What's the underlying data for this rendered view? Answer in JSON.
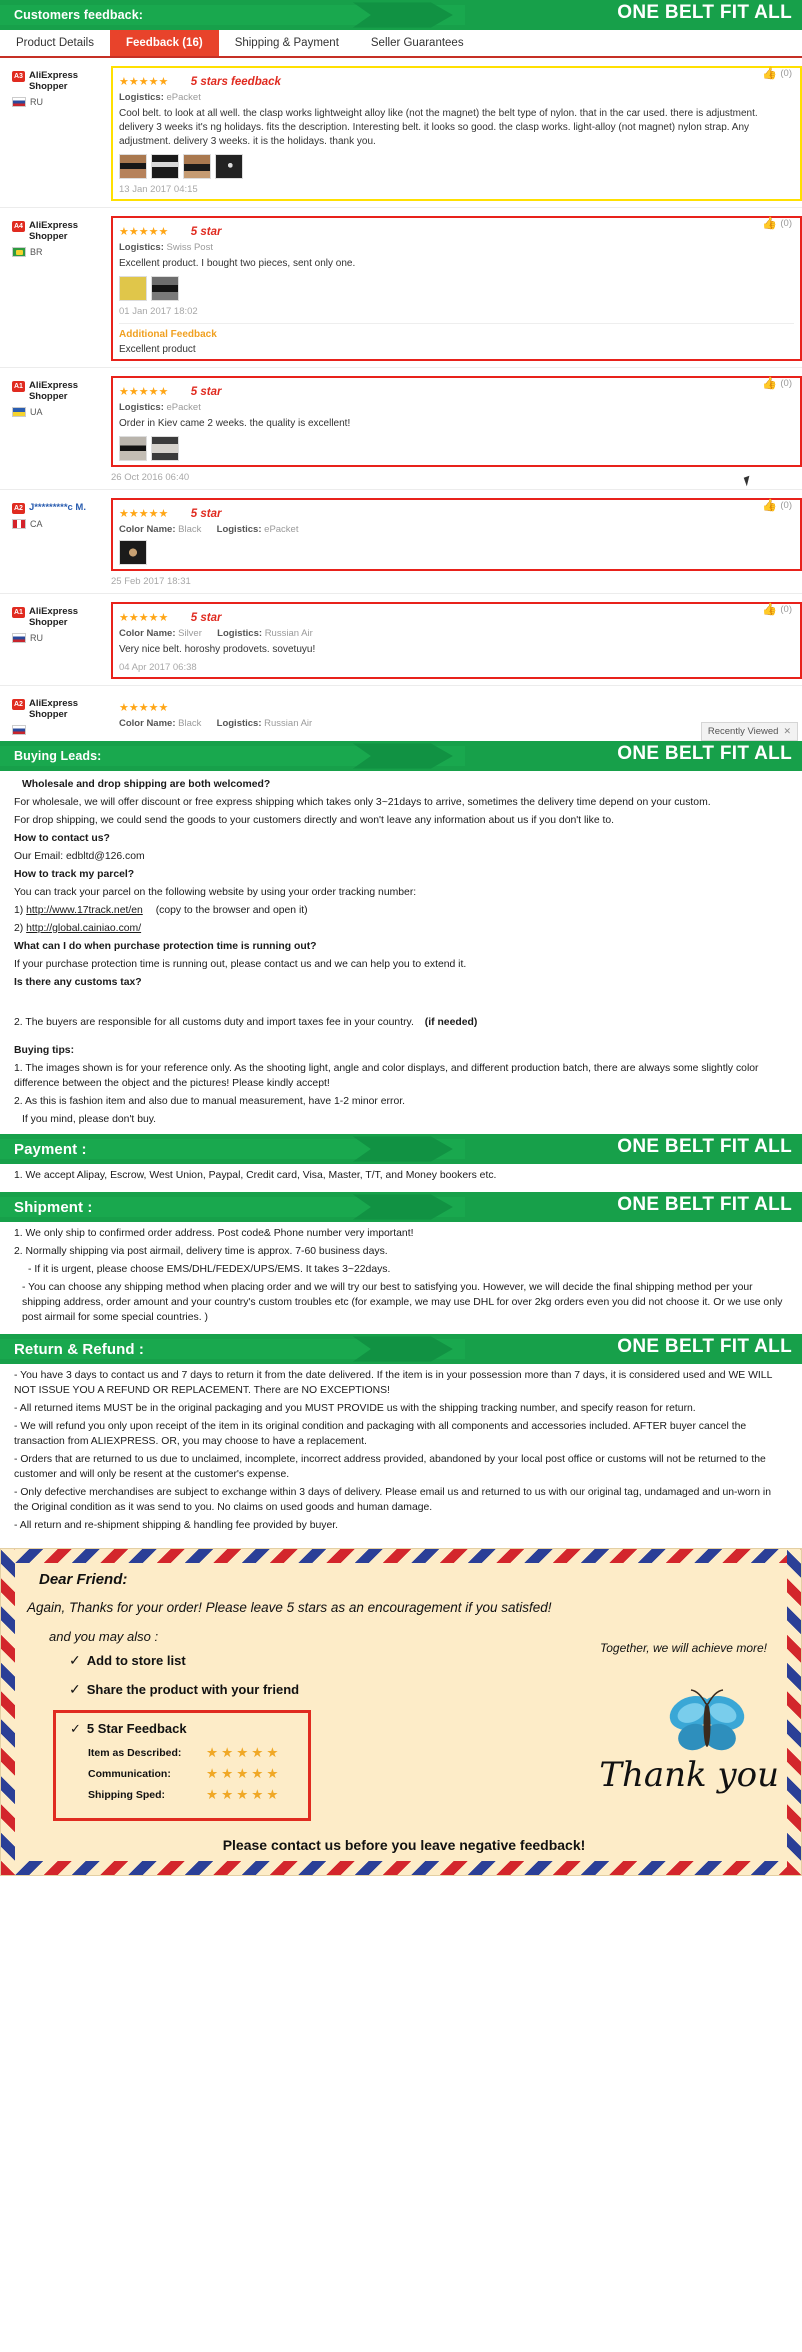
{
  "banners": {
    "customers_feedback": "Customers feedback:",
    "buying_leads": "Buying Leads:",
    "payment": "Payment :",
    "shipment": "Shipment :",
    "return_refund": "Return & Refund :",
    "slogan": "ONE BELT FIT ALL"
  },
  "tabs": [
    {
      "label": "Product Details",
      "active": false
    },
    {
      "label": "Feedback (16)",
      "active": true
    },
    {
      "label": "Shipping & Payment",
      "active": false
    },
    {
      "label": "Seller Guarantees",
      "active": false
    }
  ],
  "feedback": [
    {
      "badge": "A3",
      "username": "AliExpress Shopper",
      "country": "RU",
      "flag": "flag-ru",
      "stars": "★★★★★",
      "note": "5 stars feedback",
      "meta_label": "Logistics:",
      "meta_value": "ePacket",
      "text": "Cool belt. to look at all well. the clasp works lightweight alloy like (not the magnet) the belt type of nylon. that in the car used. there is adjustment. delivery 3 weeks it's ng holidays. fits the description. Interesting belt. it looks so good. the clasp works. light-alloy (not magnet) nylon strap. Any adjustment. delivery 3 weeks. it is the holidays. thank you.",
      "thumbs": [
        "t1",
        "t2",
        "t3",
        "t4"
      ],
      "date": "13 Jan 2017 04:15",
      "helpful": "(0)",
      "outline": "yellow"
    },
    {
      "badge": "A4",
      "username": "AliExpress Shopper",
      "country": "BR",
      "flag": "flag-br",
      "stars": "★★★★★",
      "note": "5 star",
      "meta_label": "Logistics:",
      "meta_value": "Swiss Post",
      "text": "Excellent product. I bought two pieces, sent only one.",
      "thumbs": [
        "y1",
        "y2"
      ],
      "date": "01 Jan 2017 18:02",
      "additional_title": "Additional Feedback",
      "additional_text": "Excellent product",
      "helpful": "(0)",
      "outline": "red"
    },
    {
      "badge": "A1",
      "username": "AliExpress Shopper",
      "country": "UA",
      "flag": "flag-ua",
      "stars": "★★★★★",
      "note": "5 star",
      "meta_label": "Logistics:",
      "meta_value": "ePacket",
      "text": "Order in Kiev came 2 weeks. the quality is excellent!",
      "thumbs": [
        "g1",
        "g2"
      ],
      "date": "26 Oct 2016 06:40",
      "helpful": "(0)",
      "outline": "red"
    },
    {
      "badge": "A2",
      "username": "J*********c M.",
      "country": "CA",
      "flag": "flag-ca",
      "stars": "★★★★★",
      "note": "5 star",
      "color_label": "Color Name:",
      "color_value": "Black",
      "meta_label": "Logistics:",
      "meta_value": "ePacket",
      "text": "",
      "thumbs": [
        "blk"
      ],
      "date": "25 Feb 2017 18:31",
      "helpful": "(0)",
      "outline": "red"
    },
    {
      "badge": "A1",
      "username": "AliExpress Shopper",
      "country": "RU",
      "flag": "flag-ru",
      "stars": "★★★★★",
      "note": "5 star",
      "color_label": "Color Name:",
      "color_value": "Silver",
      "meta_label": "Logistics:",
      "meta_value": "Russian Air",
      "text": "Very nice belt. horoshy prodovets. sovetuyu!",
      "thumbs": [],
      "date": "04 Apr 2017 06:38",
      "helpful": "(0)",
      "outline": "red"
    },
    {
      "badge": "A2",
      "username": "AliExpress Shopper",
      "country": "",
      "flag": "flag-ru",
      "stars": "★★★★★",
      "note": "",
      "color_label": "Color Name:",
      "color_value": "Black",
      "meta_label": "Logistics:",
      "meta_value": "Russian Air",
      "text": "",
      "thumbs": [],
      "date": "",
      "helpful": "",
      "outline": "none"
    }
  ],
  "recently_viewed": {
    "label": "Recently Viewed",
    "close": "✕"
  },
  "leads": {
    "q1": "Wholesale and drop shipping are both welcomed?",
    "a1a": "For wholesale, we will offer discount or free express shipping which takes only 3~21days to arrive, sometimes the delivery time depend on your custom.",
    "a1b": "For drop shipping, we could send the goods to your customers directly and won't leave any information about us if you don't like to.",
    "q2": "How to contact us?",
    "a2": "Our Email: edbltd@126.com",
    "q3": "How to track my parcel?",
    "a3": "You can track your parcel on the following website by using your order tracking number:",
    "link1_prefix": "1)",
    "link1": "http://www.17track.net/en",
    "link1_note": "(copy to the browser and open it)",
    "link2_prefix": "2)",
    "link2": "http://global.cainiao.com/",
    "q4": "What can I do when purchase protection time is running out?",
    "a4": "If your purchase protection time is running out, please contact us and we can help you to extend it.",
    "q5": "Is there any customs tax?",
    "a5": "2. The buyers are responsible for all customs duty and import taxes fee in your country.",
    "a5_bold": "(if needed)",
    "tips_title": "Buying tips:",
    "tip1": "1. The images shown is for your reference only. As the shooting light, angle and color displays, and different production batch, there are always some slightly color difference between the object and the pictures! Please kindly accept!",
    "tip2": "2. As this is fashion item and also due to manual measurement, have 1-2 minor error.",
    "tip3": "If you mind, please don't buy."
  },
  "payment": {
    "line1": "1. We accept Alipay, Escrow, West Union, Paypal, Credit card, Visa, Master, T/T, and Money bookers etc."
  },
  "shipment": {
    "line1": "1. We only ship to confirmed order address. Post code& Phone number very important!",
    "line2": "2. Normally shipping via post airmail, delivery time is approx. 7-60 business days.",
    "line3": "- If it is urgent, please choose EMS/DHL/FEDEX/UPS/EMS. It takes 3~22days.",
    "line4": "- You can choose any shipping method when placing order and we will try our best to satisfying you. However, we will decide the final shipping method per your shipping address, order amount and your country's custom troubles etc (for example, we may use DHL for over 2kg orders even you did not choose it. Or we use only post airmail for some special countries. )"
  },
  "returns": {
    "line1": "- You have 3 days to contact us and 7 days to return it from the date delivered. If the item is in your possession more than 7 days, it is considered used and WE WILL NOT ISSUE YOU A REFUND OR REPLACEMENT. There are NO EXCEPTIONS!",
    "line2": "- All returned items MUST be in the original packaging and you MUST PROVIDE us with the shipping tracking number, and specify reason for return.",
    "line3": "- We will refund you only upon receipt of the item in its original condition and packaging with all components and accessories included. AFTER buyer cancel the transaction from ALIEXPRESS. OR, you may choose to have a replacement.",
    "line4": "- Orders that are returned to us due to unclaimed, incomplete, incorrect address provided, abandoned by your local post office or customs will not be returned to the customer and will only be resent at the customer's expense.",
    "line5": "- Only defective merchandises are subject to exchange within 3 days of delivery. Please email us and returned to us with our original tag, undamaged and un-worn in the Original condition as it was send to you. No claims on used goods and human damage.",
    "line6": "- All return and re-shipment shipping & handling fee provided by buyer."
  },
  "thank_you": {
    "dear": "Dear Friend:",
    "line1": "Again, Thanks for your order! Please leave 5 stars as an encouragement if you satisfed!",
    "also": "and you may also :",
    "check1": "Add to store list",
    "check2": "Share the product with your friend",
    "check3": "5 Star Feedback",
    "together": "Together, we will achieve more!",
    "rate_rows": [
      {
        "label": "Item as Described:",
        "stars": "★★★★★"
      },
      {
        "label": "Communication:",
        "stars": "★★★★★"
      },
      {
        "label": "Shipping Sped:",
        "stars": "★★★★★"
      }
    ],
    "script": "Thank you",
    "footer": "Please contact us before you leave negative feedback!"
  },
  "colors": {
    "green": "#17a04a",
    "red": "#e8432b",
    "star_orange": "#ffa616",
    "outline_yellow": "#ffe000",
    "outline_red": "#e8221b",
    "cream": "#fdecc8"
  }
}
